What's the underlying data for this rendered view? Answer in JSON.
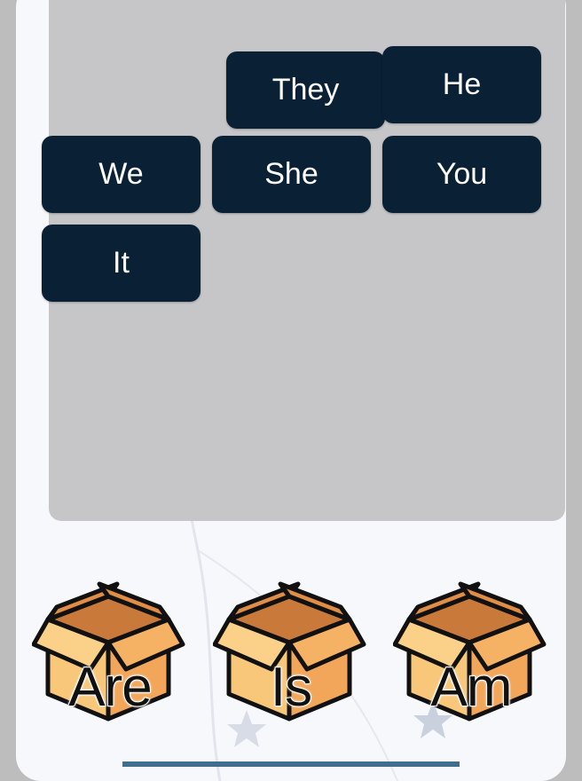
{
  "game": {
    "pronoun_tiles": [
      {
        "label": "They"
      },
      {
        "label": "He"
      },
      {
        "label": "We"
      },
      {
        "label": "She"
      },
      {
        "label": "You"
      },
      {
        "label": "It"
      }
    ],
    "verb_boxes": [
      {
        "label": "Are"
      },
      {
        "label": "Is"
      },
      {
        "label": "Am"
      }
    ]
  },
  "colors": {
    "tile": "#0a2035",
    "board": "#c6c6c8",
    "box_orange": "#f2a65a",
    "box_light": "#f8c77a"
  }
}
